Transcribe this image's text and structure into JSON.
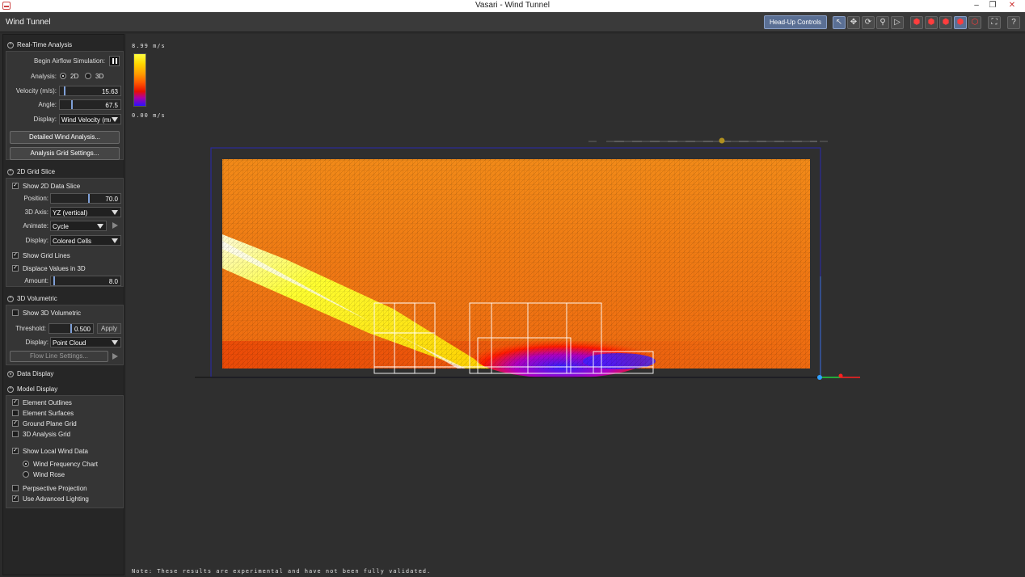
{
  "window": {
    "title": "Vasari - Wind Tunnel",
    "minimize": "–",
    "restore": "❐",
    "close": "✕"
  },
  "panel_title": "Wind Tunnel",
  "toolbar": {
    "hud_label": "Head-Up Controls",
    "tools": [
      {
        "name": "select-icon",
        "glyph": "↖"
      },
      {
        "name": "pan-icon",
        "glyph": "✥"
      },
      {
        "name": "orbit-icon",
        "glyph": "⟳"
      },
      {
        "name": "zoom-icon",
        "glyph": "⚲"
      },
      {
        "name": "play-icon",
        "glyph": "▷"
      },
      {
        "name": "view-cube-front-icon",
        "glyph": "⬢"
      },
      {
        "name": "view-cube-right-icon",
        "glyph": "⬢"
      },
      {
        "name": "view-cube-top-icon",
        "glyph": "⬢"
      },
      {
        "name": "view-cube-iso-icon",
        "glyph": "⬢"
      },
      {
        "name": "view-cube-outline-icon",
        "glyph": "⬡"
      },
      {
        "name": "fit-view-icon",
        "glyph": "⛶"
      },
      {
        "name": "help-icon",
        "glyph": "?"
      }
    ]
  },
  "realtime": {
    "header": "Real-Time Analysis",
    "begin_label": "Begin Airflow Simulation:",
    "analysis_label": "Analysis:",
    "opt_2d": "2D",
    "opt_3d": "3D",
    "velocity_label": "Velocity (m/s):",
    "velocity_value": "15.63",
    "velocity_fraction": 0.07,
    "angle_label": "Angle:",
    "angle_value": "67.5",
    "angle_fraction": 0.19,
    "display_label": "Display:",
    "display_value": "Wind Velocity (m/",
    "detailed_button": "Detailed Wind Analysis...",
    "grid_button": "Analysis Grid Settings..."
  },
  "slice": {
    "header": "2D Grid Slice",
    "show_label": "Show 2D Data Slice",
    "position_label": "Position:",
    "position_value": "70.0",
    "position_fraction": 0.55,
    "axis_label": "3D Axis:",
    "axis_value": "YZ (vertical)",
    "animate_label": "Animate:",
    "animate_value": "Cycle",
    "display_label": "Display:",
    "display_value": "Colored Cells",
    "grid_lines_label": "Show Grid Lines",
    "displace_label": "Displace Values in 3D",
    "amount_label": "Amount:",
    "amount_value": "8.0",
    "amount_fraction": 0.04
  },
  "volumetric": {
    "header": "3D Volumetric",
    "show_label": "Show 3D Volumetric",
    "threshold_label": "Threshold:",
    "threshold_value": "0.500",
    "apply_label": "Apply",
    "display_label": "Display:",
    "display_value": "Point Cloud",
    "flow_button": "Flow Line Settings..."
  },
  "data_display": {
    "header": "Data Display"
  },
  "model_display": {
    "header": "Model Display",
    "element_outlines": "Element Outlines",
    "element_surfaces": "Element Surfaces",
    "ground_plane": "Ground Plane Grid",
    "analysis_grid": "3D Analysis Grid",
    "local_wind": "Show Local Wind Data",
    "wind_freq": "Wind Frequency Chart",
    "wind_rose": "Wind Rose",
    "perspective": "Perpsective Projection",
    "lighting": "Use Advanced Lighting"
  },
  "viewport": {
    "legend_max": "8.99 m/s",
    "legend_min": "0.00 m/s",
    "note": "Note: These results are experimental and have not been fully validated."
  },
  "colors": {
    "accent": "#5a6f94",
    "slider": "#7fa0d8",
    "field": "#f07f12",
    "axis_x": "#ff2020",
    "axis_y": "#20d040",
    "axis_z": "#30a0ff"
  }
}
